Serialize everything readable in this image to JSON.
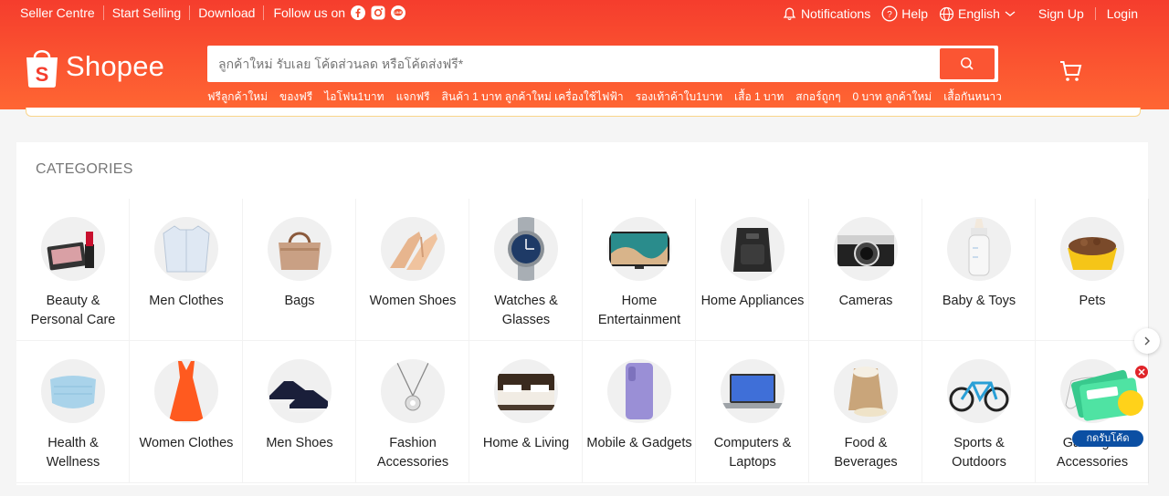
{
  "colors": {
    "brand": "#ee4d2d",
    "search_button": "#fb5533",
    "notice_border": "#fad58a"
  },
  "topbar": {
    "left_links": [
      "Seller Centre",
      "Start Selling",
      "Download"
    ],
    "follow_label": "Follow us on",
    "social_icons": [
      "facebook-icon",
      "instagram-icon",
      "line-icon"
    ],
    "notifications": "Notifications",
    "help": "Help",
    "language": "English",
    "signup": "Sign Up",
    "login": "Login"
  },
  "header": {
    "logo_text": "Shopee",
    "search": {
      "placeholder": "ลูกค้าใหม่ รับเลย โค้ดส่วนลด หรือโค้ดส่งฟรี*",
      "value": ""
    },
    "suggestions": [
      "ฟรีลูกค้าใหม่",
      "ของฟรี",
      "ไอโฟน1บาท",
      "แจกฟรี",
      "สินค้า 1 บาท ลูกค้าใหม่ เครื่องใช้ไฟฟ้า",
      "รองเท้าค้าใบ1บาท",
      "เสื้อ 1 บาท",
      "สกอร์ถูกๆ",
      "0 บาท ลูกค้าใหม่",
      "เสื้อกันหนาว"
    ]
  },
  "categories": {
    "title": "CATEGORIES",
    "items": [
      {
        "label": "Beauty & Personal Care",
        "icon": "lipstick-icon"
      },
      {
        "label": "Men Clothes",
        "icon": "shirt-icon"
      },
      {
        "label": "Bags",
        "icon": "handbag-icon"
      },
      {
        "label": "Women Shoes",
        "icon": "high-heels-icon"
      },
      {
        "label": "Watches & Glasses",
        "icon": "watch-icon"
      },
      {
        "label": "Home Entertainment",
        "icon": "tv-icon"
      },
      {
        "label": "Home Appliances",
        "icon": "air-fryer-icon"
      },
      {
        "label": "Cameras",
        "icon": "camera-icon"
      },
      {
        "label": "Baby & Toys",
        "icon": "baby-bottle-icon"
      },
      {
        "label": "Pets",
        "icon": "pet-bowl-icon"
      },
      {
        "label": "Health & Wellness",
        "icon": "face-mask-icon"
      },
      {
        "label": "Women Clothes",
        "icon": "dress-icon"
      },
      {
        "label": "Men Shoes",
        "icon": "sneakers-icon"
      },
      {
        "label": "Fashion Accessories",
        "icon": "necklace-icon"
      },
      {
        "label": "Home & Living",
        "icon": "bed-icon"
      },
      {
        "label": "Mobile & Gadgets",
        "icon": "smartphone-icon"
      },
      {
        "label": "Computers & Laptops",
        "icon": "laptop-icon"
      },
      {
        "label": "Food & Beverages",
        "icon": "rice-sack-icon"
      },
      {
        "label": "Sports & Outdoors",
        "icon": "bicycle-icon"
      },
      {
        "label": "Gaming & Accessories",
        "icon": "game-controller-icon"
      }
    ]
  },
  "promo": {
    "label": "กดรับโค้ด"
  }
}
